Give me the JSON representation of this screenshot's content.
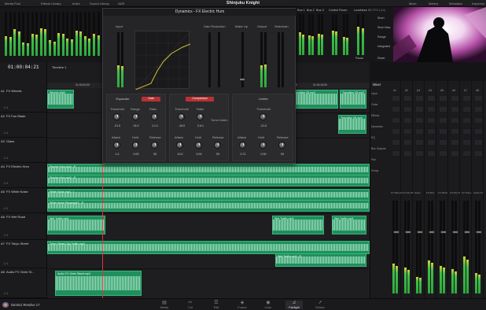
{
  "toolbar": {
    "items": [
      "Media Pool",
      "Effects Library",
      "Index",
      "Sound Library",
      "ADR"
    ],
    "project_title": "Shinjuku Knight",
    "right_items": [
      "Mixer",
      "Meters",
      "Metadata",
      "Inspector"
    ]
  },
  "transport": {
    "timecode": "01:00:04:21",
    "timeline_name": "Timeline 1"
  },
  "dynamics": {
    "title": "Dynamics - FX Electric Hum",
    "input_label": "Input",
    "gain_reduction_label": "Gain Reduction",
    "makeup_label": "Make Up",
    "output_label": "Output",
    "sidechain_label": "Sidechain",
    "expander": {
      "label": "Expander",
      "enable": "Gate",
      "knobs": [
        "Threshold",
        "Range",
        "Ratio"
      ],
      "values": [
        "-21.0",
        "24.0",
        "1:1.1"
      ],
      "knobs2": [
        "Attack",
        "Hold",
        "Release"
      ],
      "values2": [
        "1.4",
        "0.00",
        "93"
      ]
    },
    "compressor": {
      "label": "Compressor",
      "enable": "Compressor",
      "knobs": [
        "Threshold",
        "Ratio"
      ],
      "values": [
        "-15.0",
        "2.0:1"
      ],
      "send_listen": "Send  Listen",
      "knobs2": [
        "Attack",
        "Hold",
        "Release"
      ],
      "values2": [
        "10.0",
        "0.00",
        "93"
      ]
    },
    "limiter": {
      "label": "Limiter",
      "knobs": [
        "Threshold"
      ],
      "values": [
        "-21.0"
      ],
      "knobs2": [
        "Attack",
        "Hold",
        "Release"
      ],
      "values2": [
        "0.71",
        "0.00",
        "93"
      ]
    }
  },
  "bus_meters": {
    "labels": [
      "Bus 1",
      "Bus 2",
      "Bus 3"
    ],
    "control_room": "Control Room",
    "loudness": "Loudness",
    "loudness_std": "BS.1770-1 (LU)",
    "loudness_rows": [
      "Short",
      "Short Max",
      "Range",
      "Integrated"
    ],
    "loudness_values": [
      "",
      "",
      "",
      ""
    ],
    "pause": "Pause",
    "reset": "Reset"
  },
  "tracks": [
    {
      "id": "A1",
      "name": "FX Wheels",
      "vol": "-1.1"
    },
    {
      "id": "A2",
      "name": "FX Fan Blade",
      "vol": "-1.1"
    },
    {
      "id": "A3",
      "name": "Glass",
      "vol": "-1.1"
    },
    {
      "id": "A4",
      "name": "FX Electric Hum",
      "vol": "-1.1"
    },
    {
      "id": "A5",
      "name": "FX White Noise",
      "vol": "-1.1"
    },
    {
      "id": "A6",
      "name": "FX Wet Road",
      "vol": "-1.1"
    },
    {
      "id": "A7",
      "name": "FX Tokyo Street",
      "vol": "-1.1"
    },
    {
      "id": "A8",
      "name": "Audio FX Geek St...",
      "vol": "-1.1"
    }
  ],
  "clips": {
    "a1": [
      "Wheels.WAV",
      "Transition 08.mp3",
      "Transition 05.mp3"
    ],
    "a2": [
      "Transition 08.mp3"
    ],
    "a4": [
      "Electric Hum.mp3 - R",
      "Electric Hum.mp3 - R"
    ],
    "a5": [
      "White Noise.mp3 - L",
      "White Noise Resample2 - R"
    ],
    "a6": [
      "Wet Traffic.mp3",
      "Wet Traffic.mp3",
      "Wet Traffic.mp3"
    ],
    "a7": [
      "Tokyo Street City Traffic.mp3",
      "Wet Traffic.mp3 - R"
    ],
    "a8": [
      "Audio FX Geek Street.mp3"
    ]
  },
  "ruler": [
    "01:00:00:00",
    "01:00:02:00",
    "01:00:12:00",
    "01:00:14:00",
    "01:00:16:00"
  ],
  "mixer": {
    "title": "Mixer",
    "strips": [
      "A1",
      "A2",
      "A3",
      "A4",
      "A5",
      "A6",
      "A7",
      "A8"
    ],
    "strip_names": [
      "FX Wheels",
      "FX Fan Bl",
      "Glass",
      "FX Elec",
      "FX White",
      "FX Wet R",
      "FX Tokyo",
      "Audio FX"
    ],
    "row_labels": [
      "Input",
      "Order",
      "Effects",
      "Dynamics",
      "EQ",
      "Bus Outputs",
      "Pan",
      "Group"
    ],
    "levels": [
      0.32,
      0.28,
      0.18,
      0.36,
      0.3,
      0.26,
      0.4,
      0.22
    ]
  },
  "pages": [
    {
      "name": "Media",
      "icon": "▤"
    },
    {
      "name": "Cut",
      "icon": "✂"
    },
    {
      "name": "Edit",
      "icon": "☰"
    },
    {
      "name": "Fusion",
      "icon": "◈"
    },
    {
      "name": "Color",
      "icon": "◉"
    },
    {
      "name": "Fairlight",
      "icon": "♫"
    },
    {
      "name": "Deliver",
      "icon": "➚"
    }
  ],
  "app_name": "DaVinci Resolve 17",
  "active_page": "Fairlight",
  "colors": {
    "clip_green": "#1f8f5c",
    "playhead": "#d33333",
    "accent_red": "#b83232"
  }
}
